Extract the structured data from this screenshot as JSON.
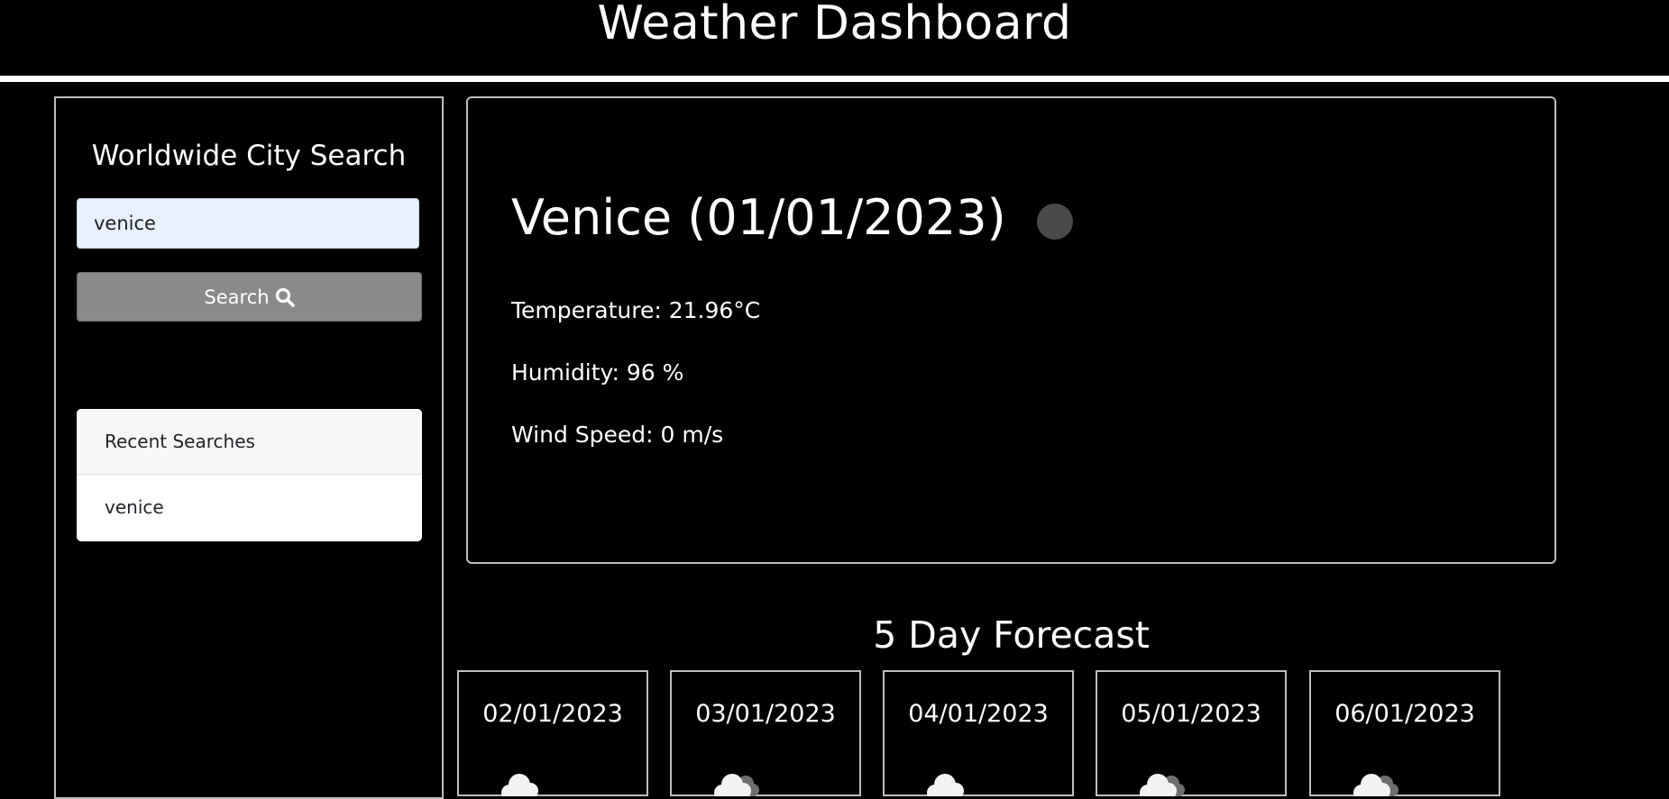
{
  "header": {
    "title": "Weather Dashboard"
  },
  "sidebar": {
    "title": "Worldwide City Search",
    "search_value": "venice",
    "search_button_label": "Search",
    "search_icon": "magnifier-icon",
    "recent": {
      "header": "Recent Searches",
      "items": [
        "venice"
      ]
    }
  },
  "current": {
    "title": "Venice (01/01/2023)",
    "icon": "weather-icon",
    "temperature": "Temperature: 21.96°C",
    "humidity": "Humidity: 96 %",
    "wind": "Wind Speed: 0 m/s"
  },
  "forecast": {
    "title": "5 Day Forecast",
    "days": [
      {
        "date": "02/01/2023",
        "icon": "cloud-icon"
      },
      {
        "date": "03/01/2023",
        "icon": "clouds-icon"
      },
      {
        "date": "04/01/2023",
        "icon": "cloud-icon"
      },
      {
        "date": "05/01/2023",
        "icon": "clouds-icon"
      },
      {
        "date": "06/01/2023",
        "icon": "clouds-icon"
      }
    ]
  },
  "colors": {
    "background": "#000000",
    "text": "#ffffff",
    "border": "#bdbdbd",
    "input_bg": "#e8f0fe",
    "button_bg": "#8a8a8a"
  }
}
